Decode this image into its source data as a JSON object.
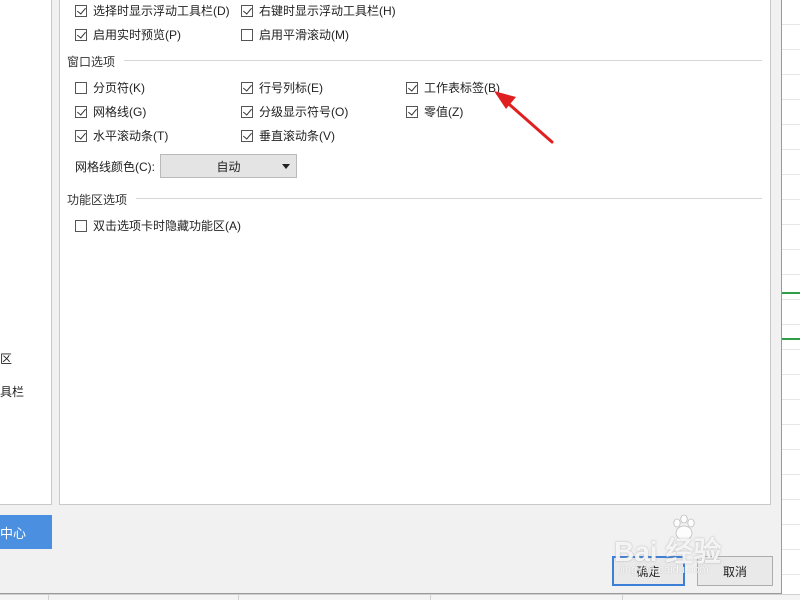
{
  "left_panel": {
    "items": [
      {
        "label": "区"
      },
      {
        "label": "具栏"
      }
    ],
    "backup_button": "中心"
  },
  "options": {
    "top_rows": [
      {
        "label": "选择时显示浮动工具栏(D)",
        "checked": true
      },
      {
        "label": "右键时显示浮动工具栏(H)",
        "checked": true
      },
      {
        "label": "启用实时预览(P)",
        "checked": true
      },
      {
        "label": "启用平滑滚动(M)",
        "checked": false
      }
    ]
  },
  "window_options": {
    "title": "窗口选项",
    "items": [
      {
        "label": "分页符(K)",
        "checked": false
      },
      {
        "label": "行号列标(E)",
        "checked": true
      },
      {
        "label": "工作表标签(B)",
        "checked": true
      },
      {
        "label": "网格线(G)",
        "checked": true
      },
      {
        "label": "分级显示符号(O)",
        "checked": true
      },
      {
        "label": "零值(Z)",
        "checked": true
      },
      {
        "label": "水平滚动条(T)",
        "checked": true
      },
      {
        "label": "垂直滚动条(V)",
        "checked": true
      }
    ],
    "grid_color_label": "网格线颜色(C):",
    "grid_color_value": "自动"
  },
  "ribbon_options": {
    "title": "功能区选项",
    "items": [
      {
        "label": "双击选项卡时隐藏功能区(A)",
        "checked": false
      }
    ]
  },
  "buttons": {
    "ok": "确定",
    "cancel": "取消"
  },
  "watermark": {
    "main": "Bai 经验",
    "sub": "jingyan.baidu.com"
  },
  "colors": {
    "accent": "#4a8fe0",
    "arrow": "#e02020",
    "green_mark": "#2e9e49"
  }
}
